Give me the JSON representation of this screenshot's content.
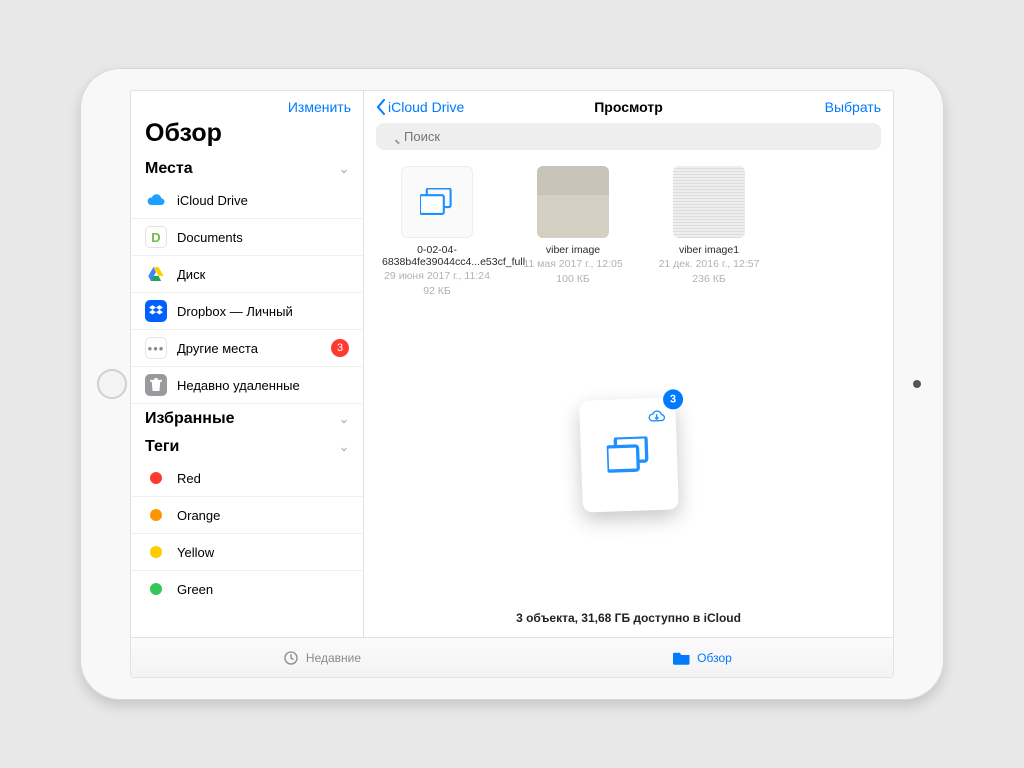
{
  "sidebar": {
    "edit_label": "Изменить",
    "title": "Обзор",
    "sections": {
      "places": {
        "header": "Места",
        "items": [
          {
            "label": "iCloud Drive"
          },
          {
            "label": "Documents"
          },
          {
            "label": "Диск"
          },
          {
            "label": "Dropbox — Личный"
          },
          {
            "label": "Другие места",
            "badge": "3"
          },
          {
            "label": "Недавно удаленные"
          }
        ]
      },
      "favorites": {
        "header": "Избранные"
      },
      "tags": {
        "header": "Теги",
        "items": [
          {
            "label": "Red",
            "color": "#ff3b30"
          },
          {
            "label": "Orange",
            "color": "#ff9500"
          },
          {
            "label": "Yellow",
            "color": "#ffcc00"
          },
          {
            "label": "Green",
            "color": "#34c759"
          }
        ]
      }
    }
  },
  "main": {
    "back_label": "iCloud Drive",
    "title": "Просмотр",
    "select_label": "Выбрать",
    "search_placeholder": "Поиск",
    "files": [
      {
        "name": "0-02-04-6838b4fe39044cc4...e53cf_full",
        "date": "29 июня 2017 г., 11:24",
        "size": "92 КБ"
      },
      {
        "name": "viber image",
        "date": "11 мая 2017 г., 12:05",
        "size": "100 КБ"
      },
      {
        "name": "viber image1",
        "date": "21 дек. 2016 г., 12:57",
        "size": "236 КБ"
      }
    ],
    "drag_count": "3",
    "status": "3 объекта, 31,68 ГБ доступно в iCloud"
  },
  "tabs": {
    "recents": "Недавние",
    "browse": "Обзор"
  }
}
